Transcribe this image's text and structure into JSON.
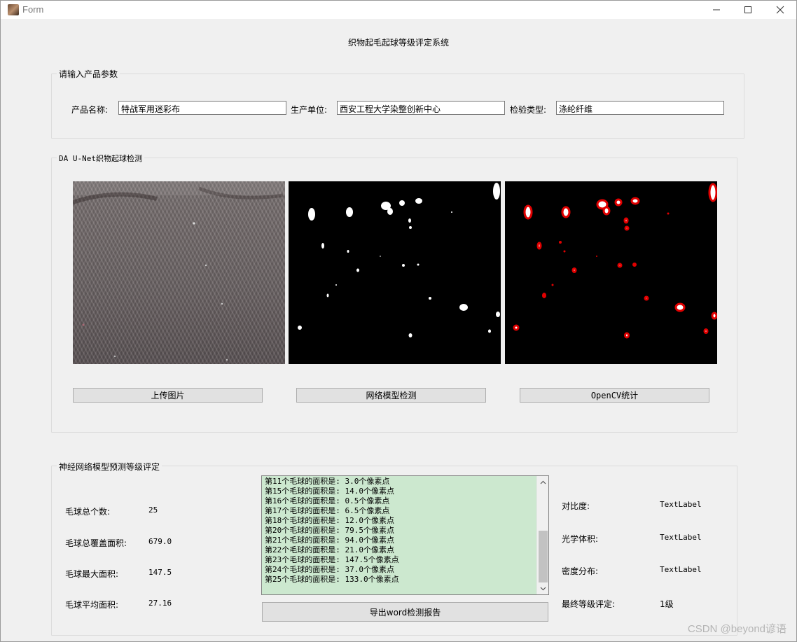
{
  "window": {
    "title": "Form"
  },
  "heading": "织物起毛起球等级评定系统",
  "params": {
    "group_title": "请输入产品参数",
    "product_name_label": "产品名称:",
    "product_name_value": "特战军用迷彩布",
    "manufacturer_label": "生产单位:",
    "manufacturer_value": "西安工程大学染整创新中心",
    "test_type_label": "检验类型:",
    "test_type_value": "涤纶纤维"
  },
  "detection": {
    "group_title": "DA U-Net织物起球检测",
    "upload_label": "上传图片",
    "network_label": "网络模型检测",
    "opencv_label": "OpenCV统计"
  },
  "rating": {
    "group_title": "神经网络模型预测等级评定",
    "total_count_label": "毛球总个数:",
    "total_count_value": "25",
    "total_area_label": "毛球总覆盖面积:",
    "total_area_value": "679.0",
    "max_area_label": "毛球最大面积:",
    "max_area_value": "147.5",
    "avg_area_label": "毛球平均面积:",
    "avg_area_value": "27.16",
    "log_lines": [
      "第11个毛球的面积是: 3.0个像素点",
      "第15个毛球的面积是: 14.0个像素点",
      "第16个毛球的面积是: 0.5个像素点",
      "第17个毛球的面积是: 6.5个像素点",
      "第18个毛球的面积是: 12.0个像素点",
      "第20个毛球的面积是: 79.5个像素点",
      "第21个毛球的面积是: 94.0个像素点",
      "第22个毛球的面积是: 21.0个像素点",
      "第23个毛球的面积是: 147.5个像素点",
      "第24个毛球的面积是: 37.0个像素点",
      "第25个毛球的面积是: 133.0个像素点"
    ],
    "export_label": "导出word检测报告",
    "contrast_label": "对比度:",
    "contrast_value": "TextLabel",
    "optical_volume_label": "光学体积:",
    "optical_volume_value": "TextLabel",
    "density_label": "密度分布:",
    "density_value": "TextLabel",
    "final_grade_label": "最终等级评定:",
    "final_grade_value": "1级"
  },
  "watermark": "CSDN @beyond谚语"
}
